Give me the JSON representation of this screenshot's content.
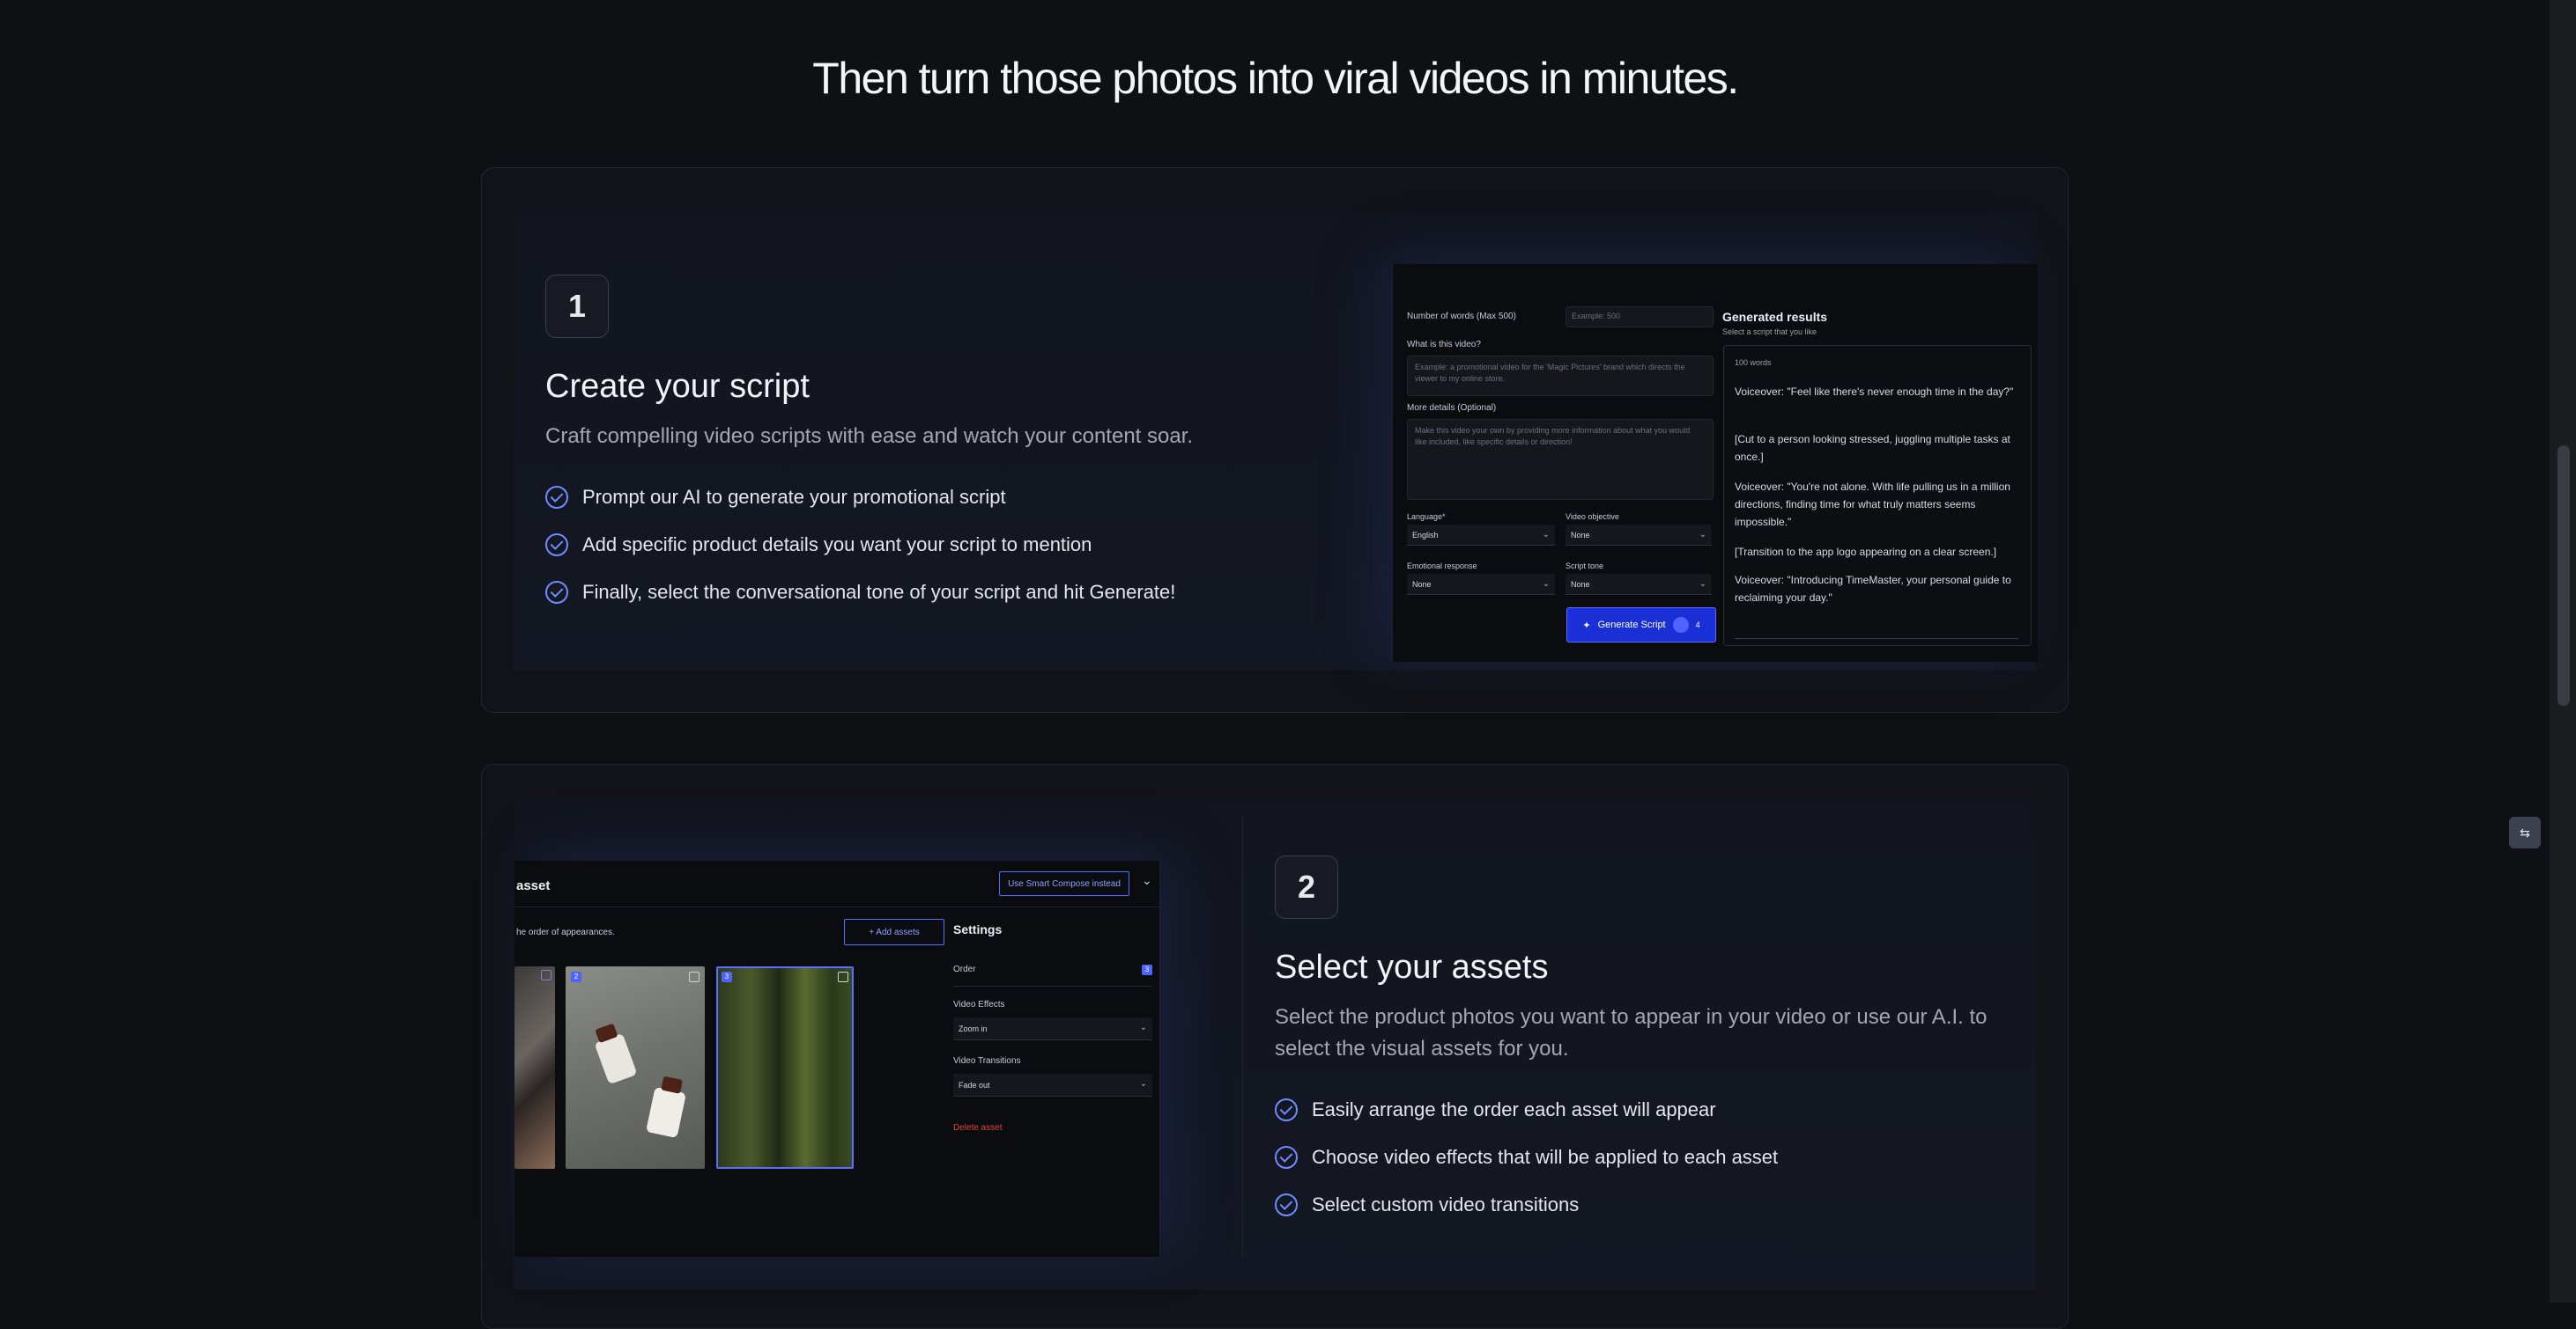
{
  "headline": "Then turn those photos into viral videos in minutes.",
  "steps": [
    {
      "number": "1",
      "title": "Create your script",
      "description": "Craft compelling video scripts with ease and watch your content soar.",
      "bullets": [
        "Prompt our AI to generate your promotional script",
        "Add specific product details you want your script to mention",
        "Finally, select the conversational tone of your script and hit Generate!"
      ]
    },
    {
      "number": "2",
      "title": "Select your assets",
      "description": "Select the product photos you want to appear in your video or use our A.I. to select the visual assets for you.",
      "bullets": [
        "Easily arrange the order each asset will appear",
        "Choose video effects that will be applied to each asset",
        "Select custom video transitions"
      ]
    }
  ],
  "script_mockup": {
    "words_label": "Number of words (Max 500)",
    "words_placeholder": "Example: 500",
    "what_label": "What is this video?",
    "what_placeholder": "Example: a promotional video for the 'Magic Pictures' brand which directs the viewer to my online store.",
    "details_label": "More details (Optional)",
    "details_placeholder": "Make this video your own by providing more information about what you would like included, like specific details or direction!",
    "language_label": "Language*",
    "language_value": "English",
    "objective_label": "Video objective",
    "objective_value": "None",
    "emotional_label": "Emotional response",
    "emotional_value": "None",
    "tone_label": "Script tone",
    "tone_value": "None",
    "generate_label": "Generate Script",
    "generate_count": "4",
    "results_title": "Generated results",
    "results_sub": "Select a script that you like",
    "results_count": "100 words",
    "results": [
      "Voiceover: \"Feel like there's never enough time in the day?\"",
      "[Cut to a person looking stressed, juggling multiple tasks at once.]",
      "Voiceover: \"You're not alone. With life pulling us in a million directions, finding time for what truly matters seems impossible.\"",
      "[Transition to the app logo appearing on a clear screen.]",
      "Voiceover: \"Introducing TimeMaster, your personal guide to reclaiming your day.\""
    ]
  },
  "assets_mockup": {
    "title": "asset",
    "smart_compose": "Use Smart Compose instead",
    "order_hint": "he order of appearances.",
    "add_assets": "+ Add assets",
    "settings_title": "Settings",
    "order_label": "Order",
    "order_value": "3",
    "effects_label": "Video Effects",
    "effects_value": "Zoom in",
    "transitions_label": "Video Transitions",
    "transitions_value": "Fade out",
    "delete_label": "Delete asset",
    "thumb_numbers": [
      "2",
      "3"
    ]
  },
  "colors": {
    "background": "#0f1013",
    "accent": "#6e8cff",
    "button_blue": "#1a2fd6",
    "danger": "#e0443a"
  }
}
